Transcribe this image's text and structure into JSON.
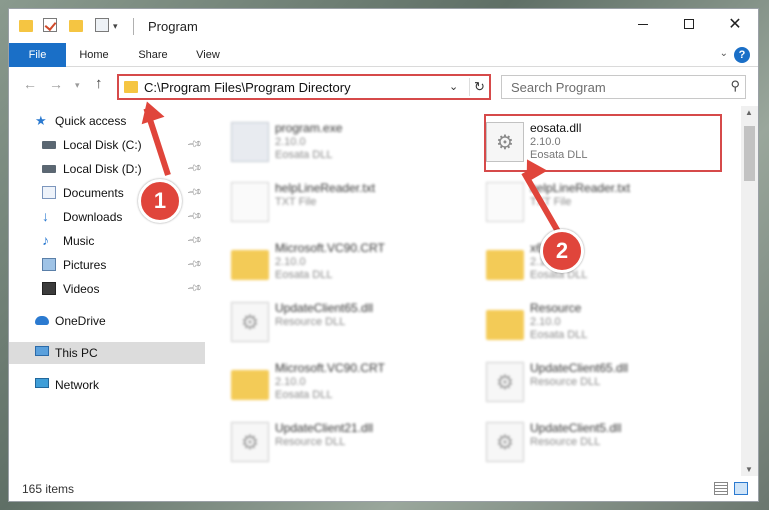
{
  "window": {
    "title": "Program",
    "min_icon": "minimize-icon",
    "max_icon": "maximize-icon",
    "close_glyph": "✕"
  },
  "ribbon": {
    "tabs": [
      "File",
      "Home",
      "Share",
      "View"
    ],
    "help_glyph": "?"
  },
  "navbar": {
    "address": "C:\\Program Files\\Program Directory",
    "search_placeholder": "Search Program"
  },
  "sidebar": {
    "items": [
      {
        "label": "Quick access",
        "icon": "star-icon"
      },
      {
        "label": "Local Disk (C:)",
        "icon": "drive-icon",
        "pinned": true
      },
      {
        "label": "Local Disk (D:)",
        "icon": "drive-icon",
        "pinned": true
      },
      {
        "label": "Documents",
        "icon": "documents-icon",
        "pinned": true
      },
      {
        "label": "Downloads",
        "icon": "download-icon",
        "pinned": true
      },
      {
        "label": "Music",
        "icon": "music-icon",
        "pinned": true
      },
      {
        "label": "Pictures",
        "icon": "pictures-icon",
        "pinned": true
      },
      {
        "label": "Videos",
        "icon": "videos-icon",
        "pinned": true
      },
      {
        "label": "OneDrive",
        "icon": "cloud-icon"
      },
      {
        "label": "This PC",
        "icon": "pc-icon",
        "selected": true
      },
      {
        "label": "Network",
        "icon": "network-icon"
      }
    ]
  },
  "files": [
    {
      "name": "program.exe",
      "line2": "2.10.0",
      "line3": "Eosata DLL",
      "icon": "exe-icon",
      "blurred": true
    },
    {
      "name": "eosata.dll",
      "line2": "2.10.0",
      "line3": "Eosata DLL",
      "icon": "dll-icon",
      "blurred": false
    },
    {
      "name": "helpLineReader.txt",
      "line2": "TXT File",
      "line3": "",
      "icon": "text-file-icon",
      "blurred": true
    },
    {
      "name": "helpLineReader.txt",
      "line2": "TXT File",
      "line3": "",
      "icon": "text-file-icon",
      "blurred": true
    },
    {
      "name": "Microsoft.VC90.CRT",
      "line2": "2.10.0",
      "line3": "Eosata DLL",
      "icon": "folder-icon",
      "blurred": true
    },
    {
      "name": "x64",
      "line2": "2.10.0",
      "line3": "Eosata DLL",
      "icon": "folder-icon",
      "blurred": true
    },
    {
      "name": "UpdateClient65.dll",
      "line2": "Resource DLL",
      "line3": "",
      "icon": "dll-icon",
      "blurred": true
    },
    {
      "name": "Resource",
      "line2": "2.10.0",
      "line3": "Eosata DLL",
      "icon": "folder-icon",
      "blurred": true
    },
    {
      "name": "Microsoft.VC90.CRT",
      "line2": "2.10.0",
      "line3": "Eosata DLL",
      "icon": "folder-icon",
      "blurred": true
    },
    {
      "name": "UpdateClient65.dll",
      "line2": "Resource DLL",
      "line3": "",
      "icon": "dll-icon",
      "blurred": true
    },
    {
      "name": "UpdateClient21.dll",
      "line2": "Resource DLL",
      "line3": "",
      "icon": "dll-icon",
      "blurred": true
    },
    {
      "name": "UpdateClient5.dll",
      "line2": "Resource DLL",
      "line3": "",
      "icon": "dll-icon",
      "blurred": true
    }
  ],
  "status": {
    "count": "165 items"
  },
  "annotations": {
    "step1": "1",
    "step2": "2",
    "color": "#e0453b"
  },
  "colors": {
    "accent": "#1a6fc7",
    "highlight": "#d64a4a",
    "folder": "#f2c23a"
  }
}
